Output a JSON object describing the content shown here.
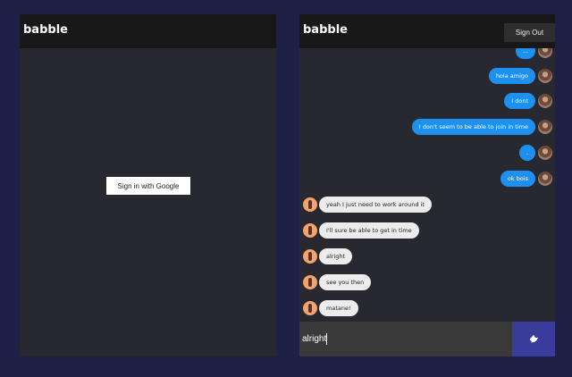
{
  "left": {
    "brand": "babble",
    "signin_label": "Sign in with Google"
  },
  "right": {
    "brand": "babble",
    "signout_label": "Sign Out",
    "messages": [
      {
        "side": "sent",
        "text": "..."
      },
      {
        "side": "sent",
        "text": "hola amigo"
      },
      {
        "side": "sent",
        "text": "I dont"
      },
      {
        "side": "sent",
        "text": "I don't seem to be able to join in time"
      },
      {
        "side": "sent",
        "text": "."
      },
      {
        "side": "sent",
        "text": "ok bois"
      },
      {
        "side": "recv",
        "text": "yeah I just need to work around it"
      },
      {
        "side": "recv",
        "text": "I'll sure be able to get in time"
      },
      {
        "side": "recv",
        "text": "alright"
      },
      {
        "side": "recv",
        "text": "see you then"
      },
      {
        "side": "recv",
        "text": "matane!"
      }
    ],
    "composer_value": "alright"
  },
  "colors": {
    "page_bg": "#1f2047",
    "screen_bg": "#282830",
    "appbar_bg": "#181818",
    "sent_bubble": "#1e90f0",
    "recv_bubble": "#ececec",
    "composer_bg": "#3a3a3a",
    "send_button": "#3b3b9c"
  },
  "icons": {
    "send": "dove-send-icon"
  }
}
